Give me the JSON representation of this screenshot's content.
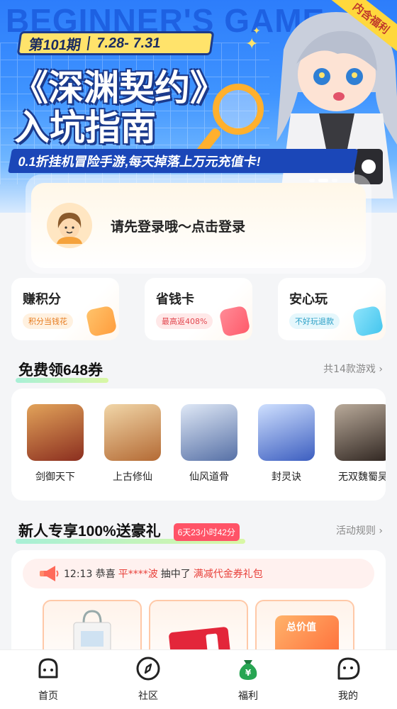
{
  "banner": {
    "bg_text": "BEGINNER'S GAME",
    "issue": "第101期",
    "dates": "7.28- 7.31",
    "title_line1": "《深渊契约》",
    "title_line2": "入坑指南",
    "subline": "0.1折挂机冒险手游,每天掉落上万元充值卡!",
    "corner_badge": "内含福利"
  },
  "login": {
    "text": "请先登录哦～点击登录"
  },
  "features": [
    {
      "title": "赚积分",
      "tag": "积分当钱花",
      "color": "#ff9d3d",
      "tag_bg": "#fff1e0",
      "tag_color": "#e67a1d"
    },
    {
      "title": "省钱卡",
      "tag": "最高返408%",
      "color": "#ff5a6a",
      "tag_bg": "#ffe8e8",
      "tag_color": "#e2474f"
    },
    {
      "title": "安心玩",
      "tag": "不好玩退款",
      "color": "#45c6ee",
      "tag_bg": "#e5f7fc",
      "tag_color": "#2a9fc6"
    }
  ],
  "coupons": {
    "title": "免费领648券",
    "link": "共14款游戏",
    "games": [
      {
        "name": "剑御天下",
        "color": "#b3452e"
      },
      {
        "name": "上古修仙",
        "color": "#c98a3e"
      },
      {
        "name": "仙风道骨",
        "color": "#6a86b8"
      },
      {
        "name": "封灵诀",
        "color": "#4a70c8"
      },
      {
        "name": "无双魏蜀吴",
        "color": "#4b3b33"
      }
    ]
  },
  "newbie": {
    "title": "新人专享100%送豪礼",
    "timer": "6天23小时42分",
    "link": "活动规则",
    "notice_time": "12:13 恭喜",
    "notice_user": "平****波",
    "notice_mid": "抽中了",
    "notice_prize": "满减代金券礼包",
    "gift_label": "总价值"
  },
  "tabs": [
    {
      "label": "首页"
    },
    {
      "label": "社区"
    },
    {
      "label": "福利"
    },
    {
      "label": "我的"
    }
  ]
}
